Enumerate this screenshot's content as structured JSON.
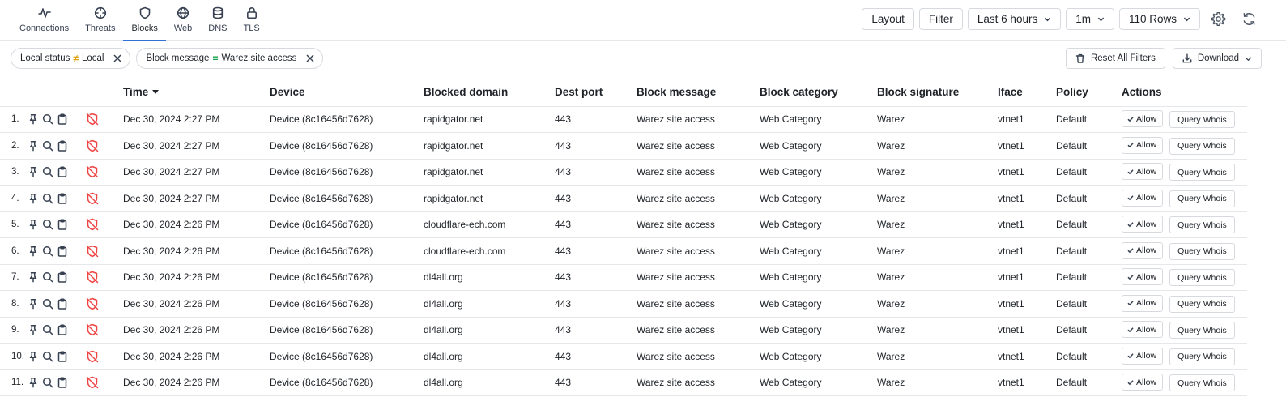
{
  "nav": {
    "tabs": [
      {
        "label": "Connections",
        "icon": "activity-icon"
      },
      {
        "label": "Threats",
        "icon": "crosshair-icon"
      },
      {
        "label": "Blocks",
        "icon": "shield-icon",
        "active": true
      },
      {
        "label": "Web",
        "icon": "globe-icon"
      },
      {
        "label": "DNS",
        "icon": "database-icon"
      },
      {
        "label": "TLS",
        "icon": "lock-icon"
      }
    ]
  },
  "toolbar": {
    "layout_label": "Layout",
    "filter_label": "Filter",
    "time_range": "Last 6 hours",
    "interval": "1m",
    "rows": "110 Rows",
    "settings_icon": "gear-icon",
    "refresh_icon": "refresh-icon"
  },
  "filters": [
    {
      "field": "Local status",
      "op": "≠",
      "value": "Local"
    },
    {
      "field": "Block message",
      "op": "=",
      "value": "Warez site access"
    }
  ],
  "actions": {
    "reset_label": "Reset All Filters",
    "download_label": "Download"
  },
  "columns": {
    "time": "Time",
    "device": "Device",
    "domain": "Blocked domain",
    "port": "Dest port",
    "message": "Block message",
    "category": "Block category",
    "signature": "Block signature",
    "iface": "Iface",
    "policy": "Policy",
    "actions": "Actions"
  },
  "row_buttons": {
    "allow": "Allow",
    "whois": "Query Whois"
  },
  "colors": {
    "accent": "#2f6fd6",
    "block_icon": "#ef4444",
    "neq_operator": "#e3a008",
    "eq_operator": "#16a34a"
  },
  "rows": [
    {
      "idx": "1.",
      "time": "Dec 30, 2024 2:27 PM",
      "device": "Device (8c16456d7628)",
      "domain": "rapidgator.net",
      "port": "443",
      "message": "Warez site access",
      "category": "Web Category",
      "signature": "Warez",
      "iface": "vtnet1",
      "policy": "Default"
    },
    {
      "idx": "2.",
      "time": "Dec 30, 2024 2:27 PM",
      "device": "Device (8c16456d7628)",
      "domain": "rapidgator.net",
      "port": "443",
      "message": "Warez site access",
      "category": "Web Category",
      "signature": "Warez",
      "iface": "vtnet1",
      "policy": "Default"
    },
    {
      "idx": "3.",
      "time": "Dec 30, 2024 2:27 PM",
      "device": "Device (8c16456d7628)",
      "domain": "rapidgator.net",
      "port": "443",
      "message": "Warez site access",
      "category": "Web Category",
      "signature": "Warez",
      "iface": "vtnet1",
      "policy": "Default"
    },
    {
      "idx": "4.",
      "time": "Dec 30, 2024 2:27 PM",
      "device": "Device (8c16456d7628)",
      "domain": "rapidgator.net",
      "port": "443",
      "message": "Warez site access",
      "category": "Web Category",
      "signature": "Warez",
      "iface": "vtnet1",
      "policy": "Default"
    },
    {
      "idx": "5.",
      "time": "Dec 30, 2024 2:26 PM",
      "device": "Device (8c16456d7628)",
      "domain": "cloudflare-ech.com",
      "port": "443",
      "message": "Warez site access",
      "category": "Web Category",
      "signature": "Warez",
      "iface": "vtnet1",
      "policy": "Default"
    },
    {
      "idx": "6.",
      "time": "Dec 30, 2024 2:26 PM",
      "device": "Device (8c16456d7628)",
      "domain": "cloudflare-ech.com",
      "port": "443",
      "message": "Warez site access",
      "category": "Web Category",
      "signature": "Warez",
      "iface": "vtnet1",
      "policy": "Default"
    },
    {
      "idx": "7.",
      "time": "Dec 30, 2024 2:26 PM",
      "device": "Device (8c16456d7628)",
      "domain": "dl4all.org",
      "port": "443",
      "message": "Warez site access",
      "category": "Web Category",
      "signature": "Warez",
      "iface": "vtnet1",
      "policy": "Default"
    },
    {
      "idx": "8.",
      "time": "Dec 30, 2024 2:26 PM",
      "device": "Device (8c16456d7628)",
      "domain": "dl4all.org",
      "port": "443",
      "message": "Warez site access",
      "category": "Web Category",
      "signature": "Warez",
      "iface": "vtnet1",
      "policy": "Default"
    },
    {
      "idx": "9.",
      "time": "Dec 30, 2024 2:26 PM",
      "device": "Device (8c16456d7628)",
      "domain": "dl4all.org",
      "port": "443",
      "message": "Warez site access",
      "category": "Web Category",
      "signature": "Warez",
      "iface": "vtnet1",
      "policy": "Default"
    },
    {
      "idx": "10.",
      "time": "Dec 30, 2024 2:26 PM",
      "device": "Device (8c16456d7628)",
      "domain": "dl4all.org",
      "port": "443",
      "message": "Warez site access",
      "category": "Web Category",
      "signature": "Warez",
      "iface": "vtnet1",
      "policy": "Default"
    },
    {
      "idx": "11.",
      "time": "Dec 30, 2024 2:26 PM",
      "device": "Device (8c16456d7628)",
      "domain": "dl4all.org",
      "port": "443",
      "message": "Warez site access",
      "category": "Web Category",
      "signature": "Warez",
      "iface": "vtnet1",
      "policy": "Default"
    }
  ]
}
